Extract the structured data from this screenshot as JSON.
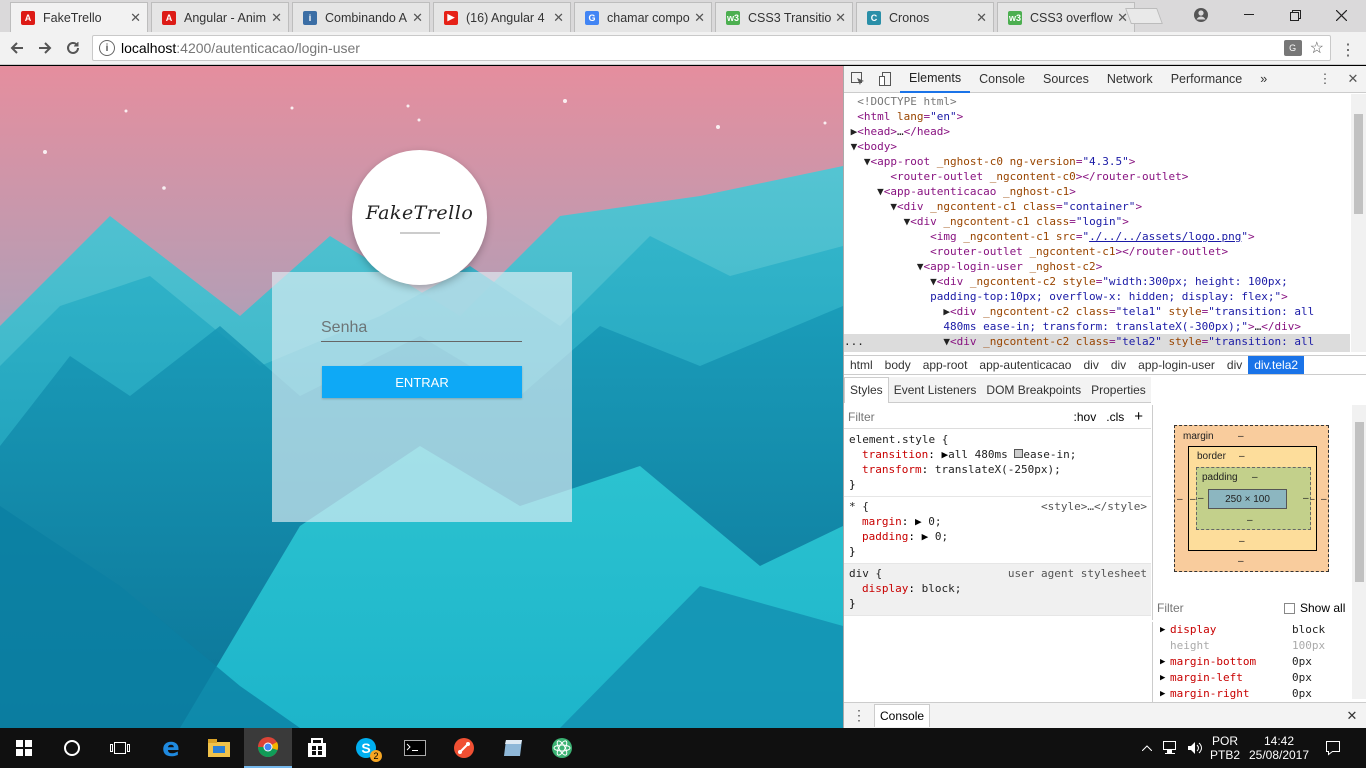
{
  "browser": {
    "tabs": [
      {
        "label": "FakeTrello",
        "icon": "angular-icon",
        "color": "#dd1b16",
        "glyph": "A"
      },
      {
        "label": "Angular - Anim",
        "icon": "angular-icon",
        "color": "#dd1b16",
        "glyph": "A"
      },
      {
        "label": "Combinando A",
        "icon": "info-icon",
        "color": "#3b6ea5",
        "glyph": "i"
      },
      {
        "label": "(16) Angular 4",
        "icon": "youtube-icon",
        "color": "#e62117",
        "glyph": "▶"
      },
      {
        "label": "chamar compo",
        "icon": "google-icon",
        "color": "#4285f4",
        "glyph": "G"
      },
      {
        "label": "CSS3 Transitio",
        "icon": "w3-icon",
        "color": "#4caf50",
        "glyph": "w3"
      },
      {
        "label": "Cronos",
        "icon": "cronos-icon",
        "color": "#2a8fa8",
        "glyph": "C"
      },
      {
        "label": "CSS3 overflow",
        "icon": "w3-icon",
        "color": "#4caf50",
        "glyph": "w3"
      }
    ],
    "url_host": "localhost",
    "url_path": ":4200/autenticacao/login-user"
  },
  "login": {
    "logo_text": "FakeTrello",
    "password_placeholder": "Senha",
    "enter_label": "ENTRAR"
  },
  "devtools": {
    "tabs": [
      "Elements",
      "Console",
      "Sources",
      "Network",
      "Performance"
    ],
    "more": "»",
    "breadcrumbs": [
      "html",
      "body",
      "app-root",
      "app-autenticacao",
      "div",
      "div",
      "app-login-user",
      "div",
      "div.tela2"
    ],
    "sub_tabs": [
      "Styles",
      "Event Listeners",
      "DOM Breakpoints",
      "Properties"
    ],
    "filter_placeholder": "Filter",
    "hov": ":hov",
    "cls": ".cls",
    "element_style_selector": "element.style {",
    "transition_prop": "transition",
    "transition_val": "all 480ms",
    "transition_ease": "ease-in;",
    "transform_prop": "transform",
    "transform_val": "translateX(-250px);",
    "star_selector": "* {",
    "star_origin": "<style>…</style>",
    "margin_prop": "margin",
    "margin_val": "0;",
    "padding_prop": "padding",
    "padding_val": "0;",
    "div_selector": "div {",
    "div_origin": "user agent stylesheet",
    "display_prop": "display",
    "display_val": "block;",
    "close_brace": "}",
    "box_model": {
      "margin": "margin",
      "border": "border",
      "padding": "padding",
      "content": "250 × 100",
      "dash": "–"
    },
    "computed_filter": "Filter",
    "show_all": "Show all",
    "computed": [
      {
        "name": "display",
        "value": "block",
        "dim": false
      },
      {
        "name": "height",
        "value": "100px",
        "dim": true
      },
      {
        "name": "margin-bottom",
        "value": "0px",
        "dim": false
      },
      {
        "name": "margin-left",
        "value": "0px",
        "dim": false
      },
      {
        "name": "margin-right",
        "value": "0px",
        "dim": false
      }
    ],
    "drawer_label": "Console"
  },
  "taskbar": {
    "language": "POR",
    "layout": "PTB2",
    "time": "14:42",
    "date": "25/08/2017",
    "skype_badge": "2"
  }
}
